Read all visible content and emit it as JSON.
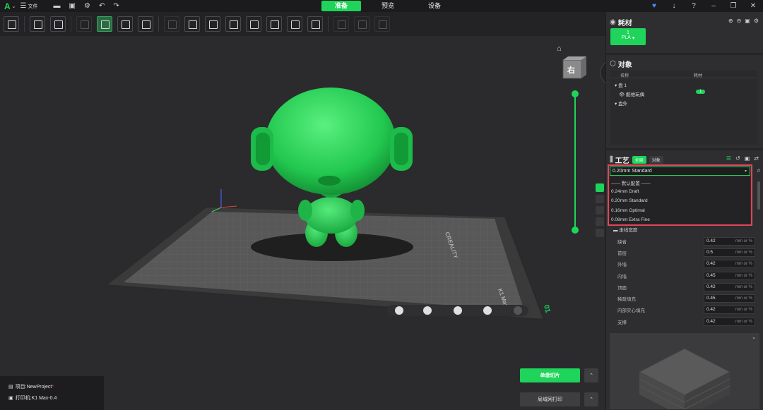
{
  "titlebar": {
    "menu_label": "文件",
    "tabs": [
      {
        "label": "准备",
        "active": true
      },
      {
        "label": "预览",
        "active": false
      },
      {
        "label": "设备",
        "active": false
      }
    ]
  },
  "viewport": {
    "view_cube_label": "右",
    "bed_text": [
      "CREALITY",
      "K1 Max"
    ]
  },
  "bottom_left": {
    "project_label": "项目:NewProject",
    "project_modified": "*",
    "printer_label": "打印机:K1 Max-0.4"
  },
  "actions": {
    "slice_label": "单盘切片",
    "print_label": "局域网打印"
  },
  "filament": {
    "title": "耗材",
    "slot_number": "1",
    "slot_type": "PLA",
    "color": "#1ed45a"
  },
  "objects": {
    "title": "对象",
    "col_name": "名称",
    "col_filament": "耗材",
    "plate_label": "盘 1",
    "object_name": "酷维玩偶",
    "object_filament": "1",
    "outside_label": "盘外"
  },
  "process": {
    "title": "工艺",
    "tab_global": "全局",
    "tab_object": "对象",
    "preset_selected": "0.20mm Standard",
    "dropdown_options": [
      "—— 默认配置 ——",
      "0.24mm Draft",
      "0.20mm Standard",
      "0.16mm Optimal",
      "0.08mm Extra Fine"
    ],
    "section_line_width": "走线宽度",
    "unit": "mm or %",
    "settings": [
      {
        "label": "缺省",
        "value": "0.42"
      },
      {
        "label": "首层",
        "value": "0.5"
      },
      {
        "label": "外墙",
        "value": "0.42"
      },
      {
        "label": "内墙",
        "value": "0.45"
      },
      {
        "label": "顶面",
        "value": "0.42"
      },
      {
        "label": "稀疏填充",
        "value": "0.45"
      },
      {
        "label": "内部实心填充",
        "value": "0.42"
      },
      {
        "label": "支撑",
        "value": "0.42"
      }
    ]
  },
  "colors": {
    "accent": "#1ed45a",
    "highlight": "#e0465a"
  }
}
